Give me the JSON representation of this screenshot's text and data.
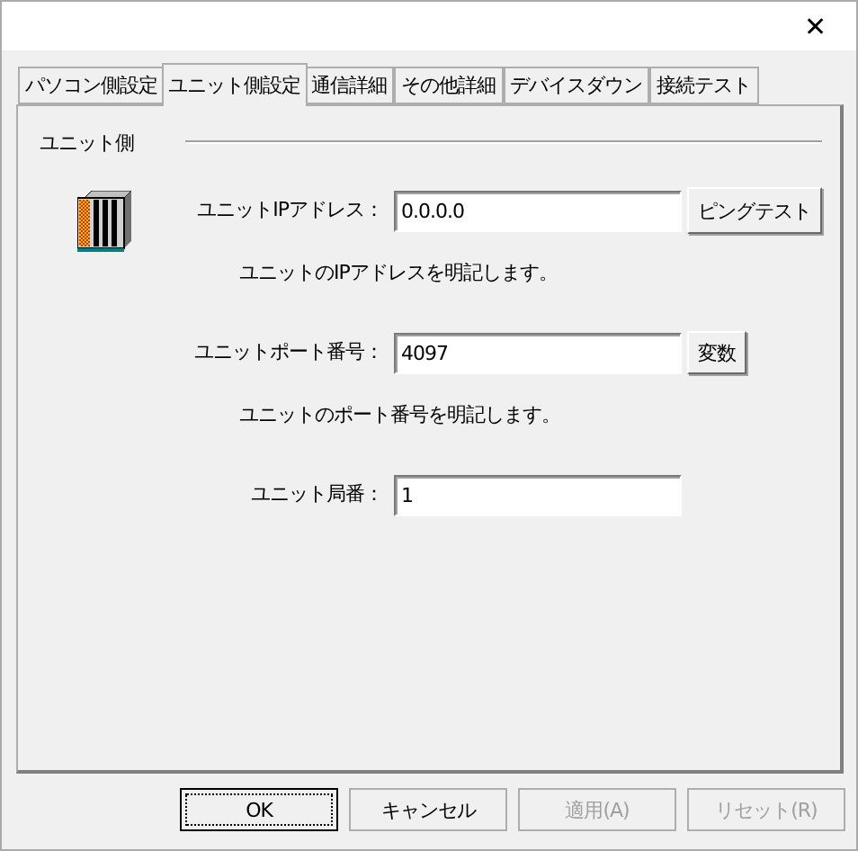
{
  "window": {
    "close": "✕"
  },
  "tabs": [
    {
      "label": "パソコン側設定",
      "selected": false
    },
    {
      "label": "ユニット側設定",
      "selected": true
    },
    {
      "label": "通信詳細",
      "selected": false
    },
    {
      "label": "その他詳細",
      "selected": false
    },
    {
      "label": "デバイスダウン",
      "selected": false
    },
    {
      "label": "接続テスト",
      "selected": false
    }
  ],
  "group": {
    "title": "ユニット側"
  },
  "fields": [
    {
      "label": "ユニットIPアドレス：",
      "value": "0.0.0.0",
      "button": "ピングテスト",
      "description": "ユニットのIPアドレスを明記します。"
    },
    {
      "label": "ユニットポート番号：",
      "value": "4097",
      "button": "変数",
      "description": "ユニットのポート番号を明記します。"
    },
    {
      "label": "ユニット局番：",
      "value": "1"
    }
  ],
  "buttons": [
    {
      "label": "OK",
      "disabled": false,
      "focused": true
    },
    {
      "label": "キャンセル",
      "disabled": false,
      "focused": false
    },
    {
      "label": "適用(A)",
      "disabled": true,
      "focused": false
    },
    {
      "label": "リセット(R)",
      "disabled": true,
      "focused": false
    }
  ]
}
